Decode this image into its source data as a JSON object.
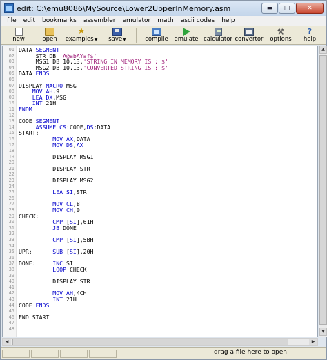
{
  "window": {
    "title": "edit: C:\\emu8086\\MySource\\Lower2UpperInMemory.asm",
    "minimize_label": "▬",
    "maximize_label": "□",
    "close_label": "✕"
  },
  "menu": [
    "file",
    "edit",
    "bookmarks",
    "assembler",
    "emulator",
    "math",
    "ascii codes",
    "help"
  ],
  "toolbar": {
    "new": "new",
    "open": "open",
    "examples": "examples",
    "save": "save",
    "compile": "compile",
    "emulate": "emulate",
    "calculator": "calculator",
    "convertor": "convertor",
    "options": "options",
    "help": "help"
  },
  "editor": {
    "lines": [
      "DATA SEGMENT",
      "     STR DB 'A@abAYaf$'",
      "     MSG1 DB 10,13,'STRING IN MEMORY IS : $'",
      "     MSG2 DB 10,13,'CONVERTED STRING IS : $'",
      "DATA ENDS",
      "",
      "DISPLAY MACRO MSG",
      "    MOV AH,9",
      "    LEA DX,MSG",
      "    INT 21H",
      "ENDM",
      "",
      "CODE SEGMENT",
      "     ASSUME CS:CODE,DS:DATA",
      "START:",
      "          MOV AX,DATA",
      "          MOV DS,AX",
      "",
      "          DISPLAY MSG1",
      "",
      "          DISPLAY STR",
      "",
      "          DISPLAY MSG2",
      "",
      "          LEA SI,STR",
      "",
      "          MOV CL,8",
      "          MOV CH,0",
      "CHECK:",
      "          CMP [SI],61H",
      "          JB DONE",
      "",
      "          CMP [SI],5BH",
      "",
      "UPR:      SUB [SI],20H",
      "",
      "DONE:     INC SI",
      "          LOOP CHECK",
      "",
      "          DISPLAY STR",
      "",
      "          MOV AH,4CH",
      "          INT 21H",
      "CODE ENDS",
      "",
      "END START",
      "",
      ""
    ]
  },
  "status": {
    "hint": "drag a file here to open"
  }
}
